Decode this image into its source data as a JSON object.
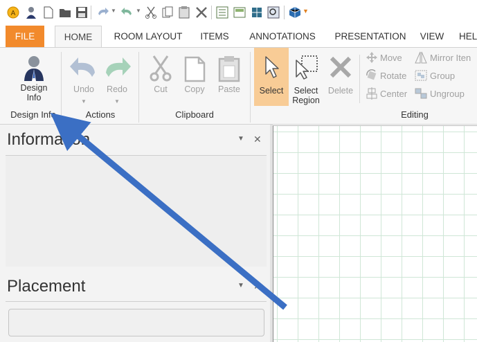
{
  "tabs": [
    "FILE",
    "HOME",
    "ROOM LAYOUT",
    "ITEMS",
    "ANNOTATIONS",
    "PRESENTATION",
    "VIEW",
    "HEL"
  ],
  "ribbon": {
    "design_info": {
      "label_line1": "Design",
      "label_line2": "Info",
      "group": "Design Info"
    },
    "actions": {
      "undo": "Undo",
      "redo": "Redo",
      "group": "Actions"
    },
    "clipboard": {
      "cut": "Cut",
      "copy": "Copy",
      "paste": "Paste",
      "group": "Clipboard"
    },
    "editing": {
      "select": "Select",
      "select_region_line1": "Select",
      "select_region_line2": "Region",
      "delete": "Delete",
      "move": "Move",
      "rotate": "Rotate",
      "center": "Center",
      "mirror": "Mirror Iten",
      "group_btn": "Group",
      "ungroup": "Ungroup",
      "group": "Editing"
    }
  },
  "panels": {
    "information": {
      "title": "Information",
      "dropdown": "▼",
      "close": "✕"
    },
    "placement": {
      "title": "Placement",
      "dropdown": "▼",
      "close": "✕"
    }
  },
  "colors": {
    "accent": "#f28a2c",
    "active_tool": "#f8cc96",
    "annotation_arrow": "#3b6fc4",
    "grid_line": "#cfe6d6"
  }
}
